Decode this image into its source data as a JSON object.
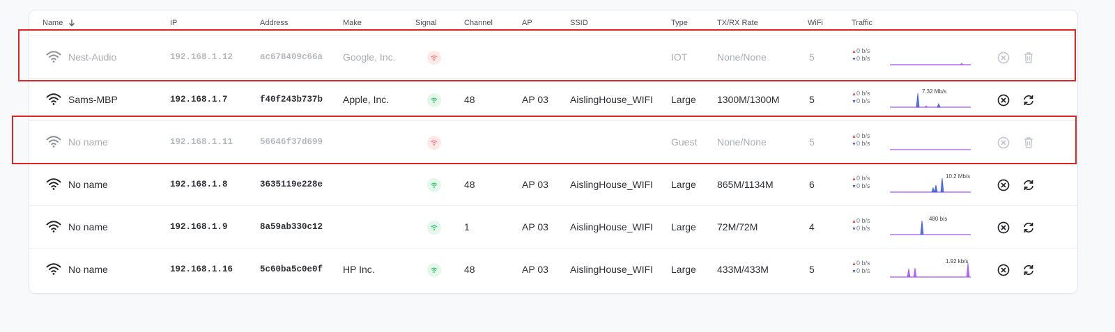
{
  "columns": {
    "name": "Name",
    "ip": "IP",
    "address": "Address",
    "make": "Make",
    "signal": "Signal",
    "channel": "Channel",
    "ap": "AP",
    "ssid": "SSID",
    "type": "Type",
    "rate": "TX/RX Rate",
    "wifi": "WiFi",
    "traffic": "Traffic"
  },
  "sort": {
    "column": "Name",
    "direction": "descending",
    "icon": "arrow-down-icon"
  },
  "colors": {
    "offline_text": "#a9adb6",
    "signal_good": "#22c55e",
    "signal_bad": "#f87171",
    "spark_line": "#a855f7",
    "spark_peak": "#3b5bdb",
    "highlight": "#e02424"
  },
  "rows": [
    {
      "name": "Nest-Audio",
      "ip": "192.168.1.12",
      "address": "ac678409c66a",
      "make": "Google, Inc.",
      "signal": "none",
      "channel": "",
      "ap": "",
      "ssid": "",
      "type": "IOT",
      "rate": "None/None",
      "wifi": "5",
      "tx": "0 b/s",
      "rx": "0 b/s",
      "peak_label": "",
      "offline": true,
      "highlighted": true
    },
    {
      "name": "Sams-MBP",
      "ip": "192.168.1.7",
      "address": "f40f243b737b",
      "make": "Apple, Inc.",
      "signal": "good",
      "channel": "48",
      "ap": "AP 03",
      "ssid": "AislingHouse_WIFI",
      "type": "Large",
      "rate": "1300M/1300M",
      "wifi": "5",
      "tx": "0 b/s",
      "rx": "0 b/s",
      "peak_label": "7.32 Mb/s",
      "offline": false,
      "highlighted": false
    },
    {
      "name": "No name",
      "ip": "192.168.1.11",
      "address": "56646f37d699",
      "make": "",
      "signal": "none",
      "channel": "",
      "ap": "",
      "ssid": "",
      "type": "Guest",
      "rate": "None/None",
      "wifi": "5",
      "tx": "0 b/s",
      "rx": "0 b/s",
      "peak_label": "",
      "offline": true,
      "highlighted": true
    },
    {
      "name": "No name",
      "ip": "192.168.1.8",
      "address": "3635119e228e",
      "make": "",
      "signal": "good",
      "channel": "48",
      "ap": "AP 03",
      "ssid": "AislingHouse_WIFI",
      "type": "Large",
      "rate": "865M/1134M",
      "wifi": "6",
      "tx": "0 b/s",
      "rx": "0 b/s",
      "peak_label": "10.2 Mb/s",
      "offline": false,
      "highlighted": false
    },
    {
      "name": "No name",
      "ip": "192.168.1.9",
      "address": "8a59ab330c12",
      "make": "",
      "signal": "good",
      "channel": "1",
      "ap": "AP 03",
      "ssid": "AislingHouse_WIFI",
      "type": "Large",
      "rate": "72M/72M",
      "wifi": "4",
      "tx": "0 b/s",
      "rx": "0 b/s",
      "peak_label": "480 b/s",
      "offline": false,
      "highlighted": false
    },
    {
      "name": "No name",
      "ip": "192.168.1.16",
      "address": "5c60ba5c0e0f",
      "make": "HP Inc.",
      "signal": "good",
      "channel": "48",
      "ap": "AP 03",
      "ssid": "AislingHouse_WIFI",
      "type": "Large",
      "rate": "433M/433M",
      "wifi": "5",
      "tx": "0 b/s",
      "rx": "0 b/s",
      "peak_label": "1.92 kb/s",
      "offline": false,
      "highlighted": false
    }
  ],
  "icons": {
    "device": "wifi-icon",
    "signal": "signal-wifi-icon",
    "disconnect": "close-circle-icon",
    "reconnect": "refresh-icon",
    "delete": "trash-icon"
  }
}
